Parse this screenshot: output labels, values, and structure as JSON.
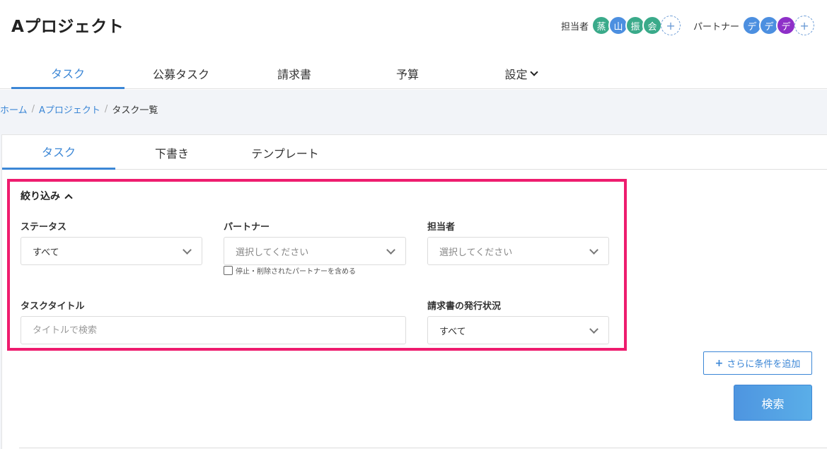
{
  "project": {
    "title": "Aプロジェクト"
  },
  "members": {
    "assignee_label": "担当者",
    "assignees": [
      {
        "initial": "蒸",
        "color": "#3aaa8a"
      },
      {
        "initial": "山",
        "color": "#4c8fe0"
      },
      {
        "initial": "振",
        "color": "#3aaa8a"
      },
      {
        "initial": "会",
        "color": "#3aaa8a"
      }
    ],
    "partner_label": "パートナー",
    "partners": [
      {
        "initial": "デ",
        "color": "#4c8fe0"
      },
      {
        "initial": "デ",
        "color": "#4c8fe0"
      },
      {
        "initial": "デ",
        "color": "#8e2fc8"
      }
    ],
    "add_symbol": "+"
  },
  "main_tabs": [
    {
      "label": "タスク",
      "active": true
    },
    {
      "label": "公募タスク",
      "active": false
    },
    {
      "label": "請求書",
      "active": false
    },
    {
      "label": "予算",
      "active": false
    },
    {
      "label": "設定",
      "active": false
    }
  ],
  "breadcrumb": {
    "home": "ホーム",
    "project": "Aプロジェクト",
    "current": "タスク一覧",
    "separator": "/"
  },
  "sub_tabs": [
    {
      "label": "タスク",
      "active": true
    },
    {
      "label": "下書き",
      "active": false
    },
    {
      "label": "テンプレート",
      "active": false
    }
  ],
  "filter": {
    "toggle_label": "絞り込み",
    "status": {
      "label": "ステータス",
      "value": "すべて"
    },
    "partner": {
      "label": "パートナー",
      "placeholder": "選択してください"
    },
    "include_stopped": "停止・削除されたパートナーを含める",
    "assignee": {
      "label": "担当者",
      "placeholder": "選択してください"
    },
    "task_title": {
      "label": "タスクタイトル",
      "placeholder": "タイトルで検索"
    },
    "invoice_status": {
      "label": "請求書の発行状況",
      "value": "すべて"
    }
  },
  "actions": {
    "add_condition_icon": "+",
    "add_condition": "さらに条件を追加",
    "search": "検索"
  },
  "colors": {
    "accent": "#3c87d6",
    "highlight_border": "#ee1c6e"
  }
}
